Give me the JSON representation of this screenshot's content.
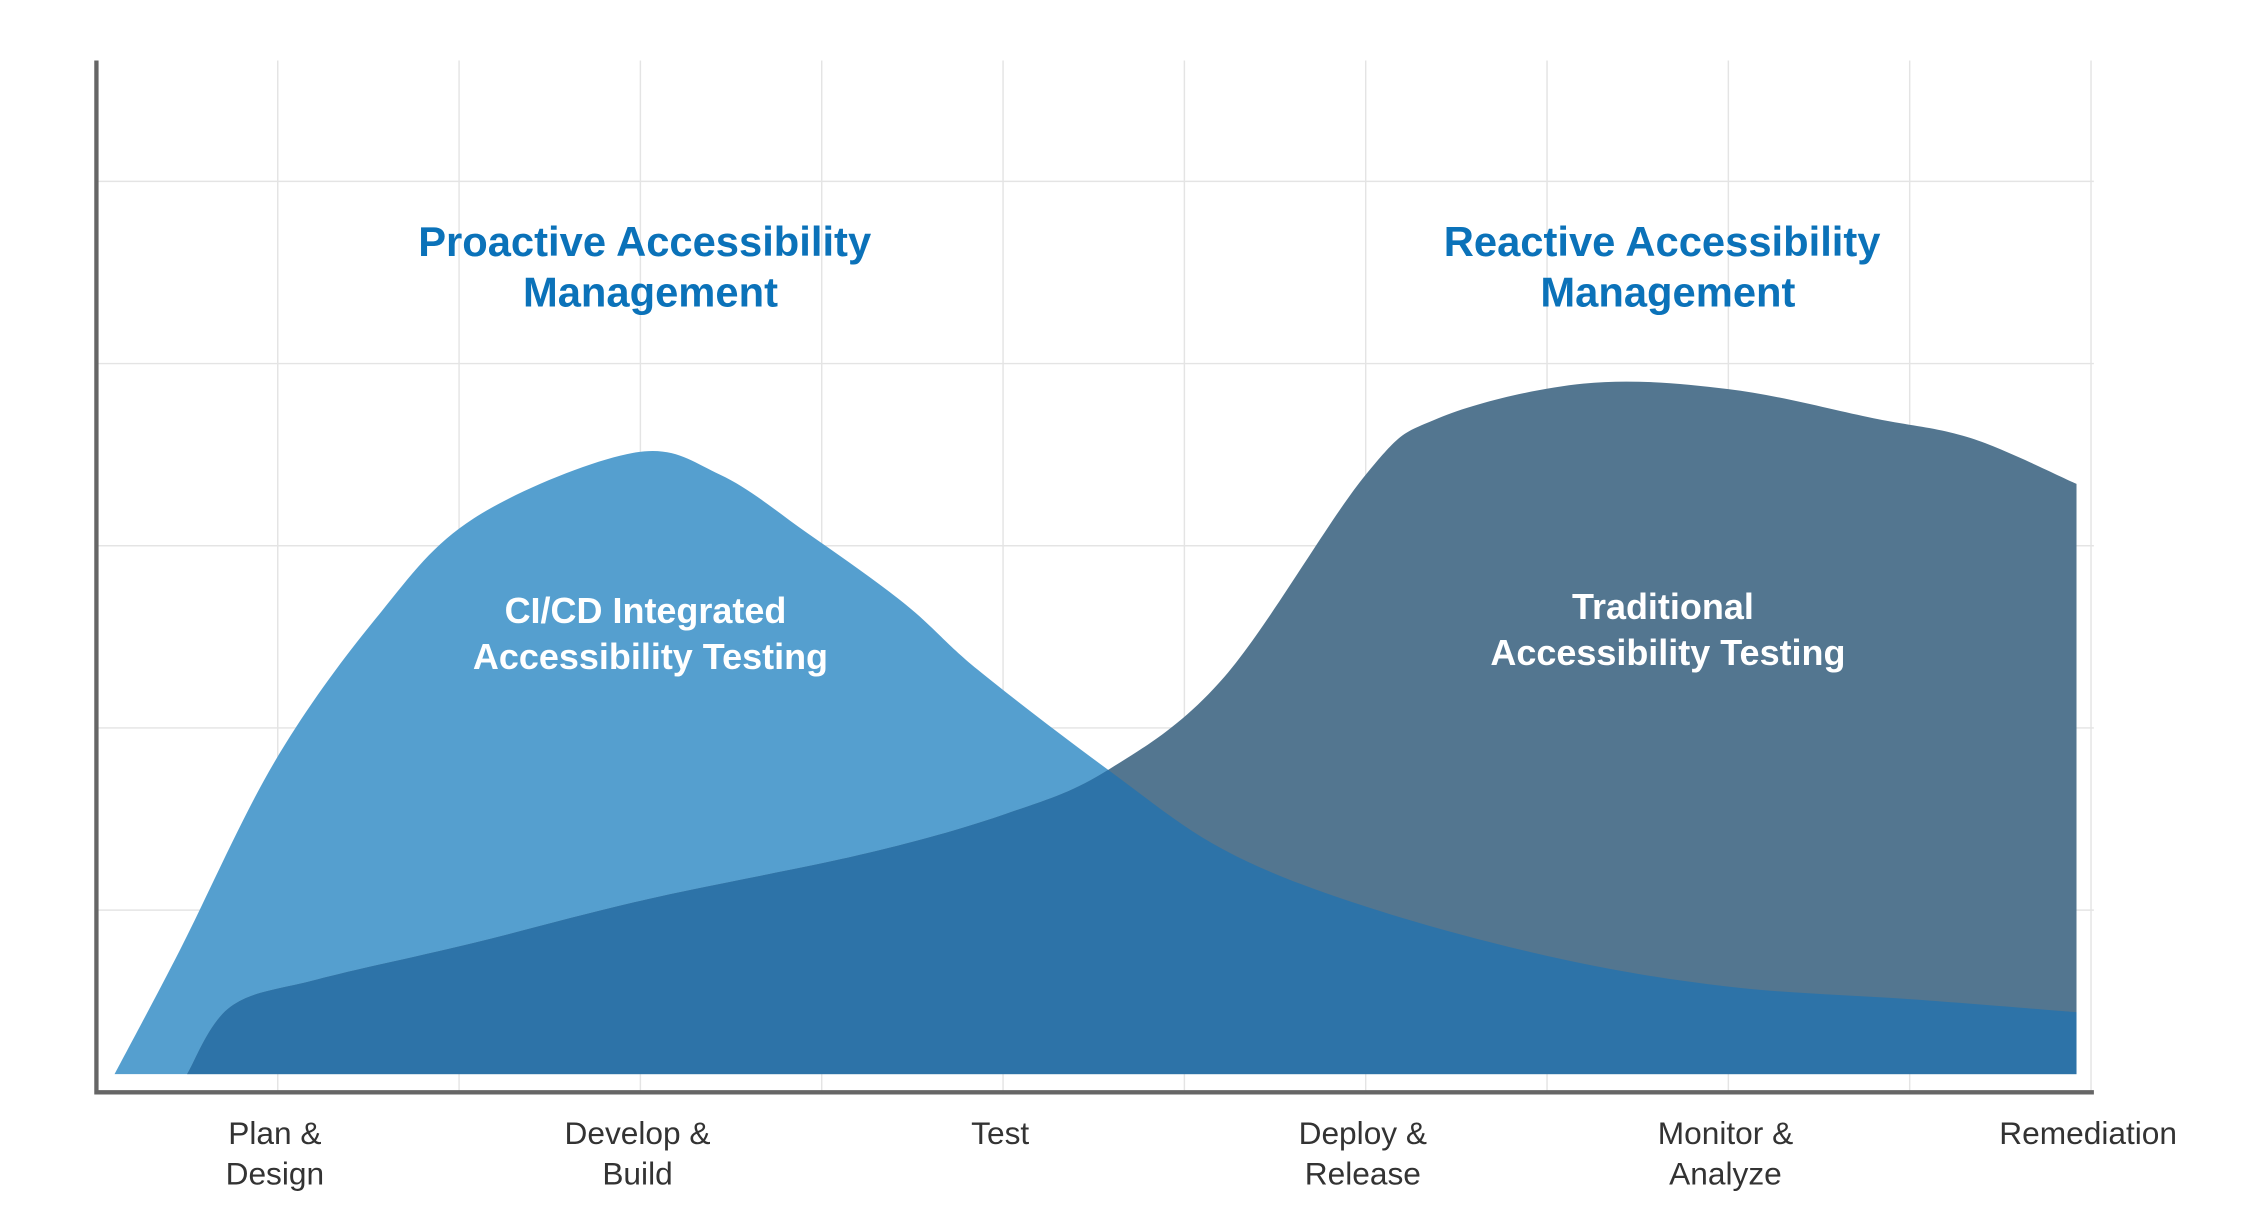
{
  "chart_data": {
    "type": "area",
    "categories": [
      [
        "Plan &",
        "Design"
      ],
      [
        "Develop &",
        "Build"
      ],
      [
        "Test"
      ],
      [
        "Deploy &",
        "Release"
      ],
      [
        "Monitor &",
        "Analyze"
      ],
      [
        "Remediation"
      ]
    ],
    "xlabel": "",
    "ylabel": "",
    "ylim": [
      0,
      5.65
    ],
    "grid": true,
    "annotations": [
      {
        "lines": [
          "Proactive Accessibility",
          "Management"
        ],
        "color": "#0b72b9"
      },
      {
        "lines": [
          "Reactive Accessibility",
          "Management"
        ],
        "color": "#0b72b9"
      }
    ],
    "series": [
      {
        "name_lines": [
          "CI/CD Integrated",
          "Accessibility Testing"
        ],
        "color": "#559fcf",
        "points": [
          [
            -0.45,
            0.1
          ],
          [
            -0.27,
            0.78
          ],
          [
            -0.01,
            1.81
          ],
          [
            0.27,
            2.6
          ],
          [
            0.54,
            3.15
          ],
          [
            0.98,
            3.51
          ],
          [
            1.22,
            3.39
          ],
          [
            1.46,
            3.07
          ],
          [
            1.73,
            2.68
          ],
          [
            1.93,
            2.32
          ],
          [
            2.29,
            1.77
          ],
          [
            2.61,
            1.33
          ],
          [
            3.0,
            1.02
          ],
          [
            3.52,
            0.74
          ],
          [
            4.0,
            0.58
          ],
          [
            4.51,
            0.51
          ],
          [
            4.96,
            0.44
          ]
        ]
      },
      {
        "name_lines": [
          "Traditional",
          "Accessibility Testing"
        ],
        "color": "#537690",
        "points": [
          [
            -0.25,
            0.1
          ],
          [
            -0.13,
            0.47
          ],
          [
            0.11,
            0.62
          ],
          [
            0.54,
            0.82
          ],
          [
            1.02,
            1.06
          ],
          [
            1.62,
            1.31
          ],
          [
            2.01,
            1.53
          ],
          [
            2.29,
            1.77
          ],
          [
            2.61,
            2.28
          ],
          [
            3.0,
            3.39
          ],
          [
            3.2,
            3.7
          ],
          [
            3.6,
            3.89
          ],
          [
            4.0,
            3.86
          ],
          [
            4.4,
            3.7
          ],
          [
            4.67,
            3.59
          ],
          [
            4.96,
            3.34
          ]
        ]
      }
    ],
    "overlap_color": "#2d73a8"
  }
}
